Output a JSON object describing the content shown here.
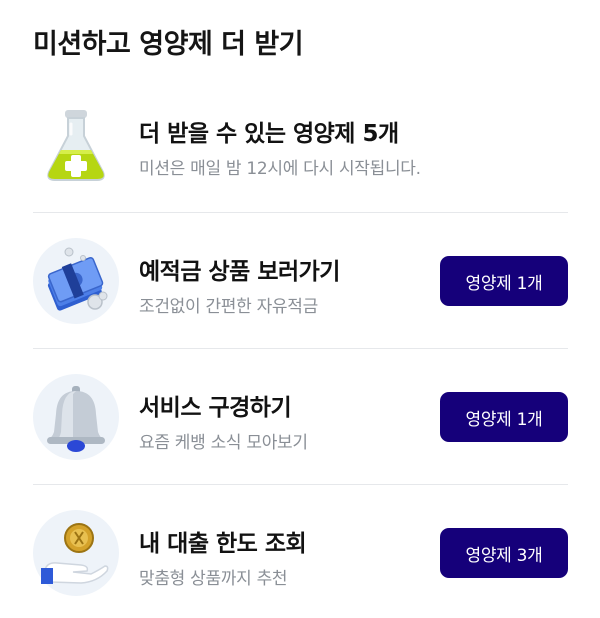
{
  "header": {
    "title": "미션하고 영양제 더 받기"
  },
  "summary": {
    "icon": "flask-icon",
    "title": "더 받을 수 있는 영양제 5개",
    "subtitle": "미션은 매일 밤 12시에 다시 시작됩니다."
  },
  "missions": [
    {
      "icon": "money-bundle-icon",
      "title": "예적금 상품 보러가기",
      "subtitle": "조건없이 간편한 자유적금",
      "reward_label": "영양제 1개"
    },
    {
      "icon": "bell-icon",
      "title": "서비스 구경하기",
      "subtitle": "요즘 케뱅 소식 모아보기",
      "reward_label": "영양제 1개"
    },
    {
      "icon": "coin-hand-icon",
      "title": "내 대출 한도 조회",
      "subtitle": "맞춤형 상품까지 추천",
      "reward_label": "영양제 3개"
    }
  ],
  "colors": {
    "accent": "#15007a",
    "subtext": "#8a8f96",
    "icon_bg": "#eef3f9",
    "divider": "#e6e8eb"
  }
}
